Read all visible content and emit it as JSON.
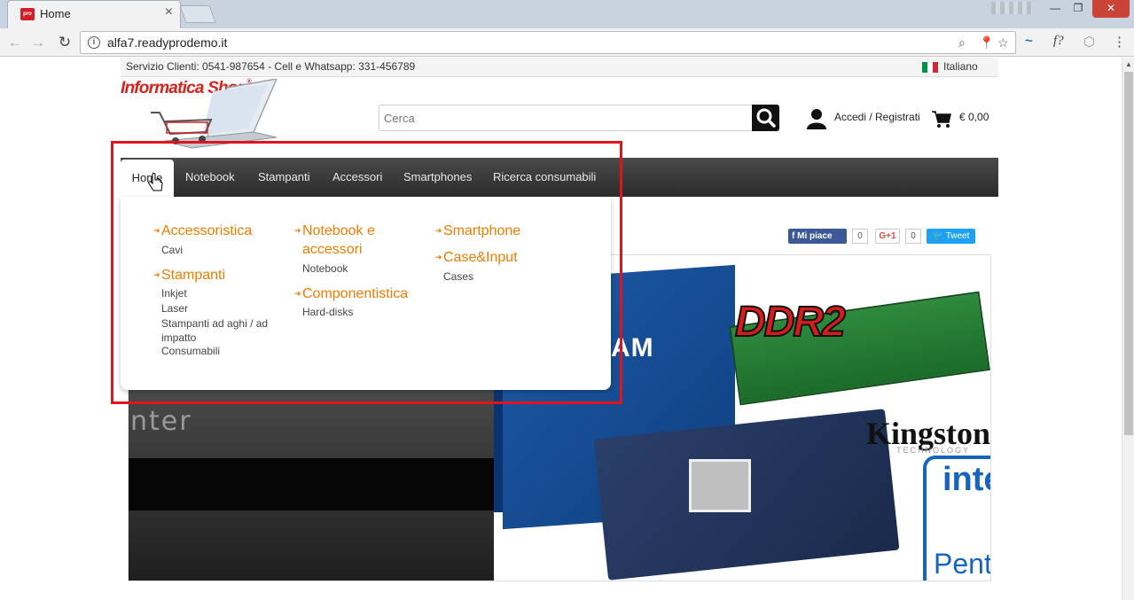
{
  "browser": {
    "tab_title": "Home",
    "tab_favicon": "pro",
    "url": "alfa7.readyprodemo.it"
  },
  "topbar": {
    "contact": "Servizio Clienti: 0541-987654 - Cell e Whatsapp: 331-456789",
    "language": "Italiano"
  },
  "logo": {
    "text": "Informatica Shop",
    "mark": "®"
  },
  "search": {
    "placeholder": "Cerca"
  },
  "account": {
    "label": "Accedi / Registrati"
  },
  "cart": {
    "total": "€ 0,00"
  },
  "menu": {
    "items": [
      "Home",
      "Notebook",
      "Stampanti",
      "Accessori",
      "Smartphones",
      "Ricerca consumabili"
    ]
  },
  "mega_menu": {
    "col1": {
      "cat1": "Accessoristica",
      "cat1_subs": [
        "Cavi"
      ],
      "cat2": "Stampanti",
      "cat2_subs": [
        "Inkjet",
        "Laser",
        "Stampanti ad aghi / ad impatto",
        "Consumabili"
      ]
    },
    "col2": {
      "cat1_line1": "Notebook e",
      "cat1_line2": "accessori",
      "cat1_subs": [
        "Notebook"
      ],
      "cat2": "Componentistica",
      "cat2_subs": [
        "Hard-disks"
      ]
    },
    "col3": {
      "cat1": "Smartphone",
      "cat2": "Case&Input",
      "cat2_subs": [
        "Cases"
      ]
    }
  },
  "social": {
    "facebook": "Mi piace",
    "facebook_count": "0",
    "gplus": "G+1",
    "gplus_count": "0",
    "twitter": "Tweet"
  },
  "slider": {
    "left_text": "nter",
    "box_text": "AM",
    "ram_text": "DDR2",
    "kingston": "Kingston",
    "kingston_sub": "TECHNOLOGY",
    "intel": "intel",
    "pentium": "Pent"
  },
  "colors": {
    "accent": "#ee7d00",
    "brand_red": "#d9221c",
    "menubar": "#333333",
    "highlight": "#e0141d"
  }
}
